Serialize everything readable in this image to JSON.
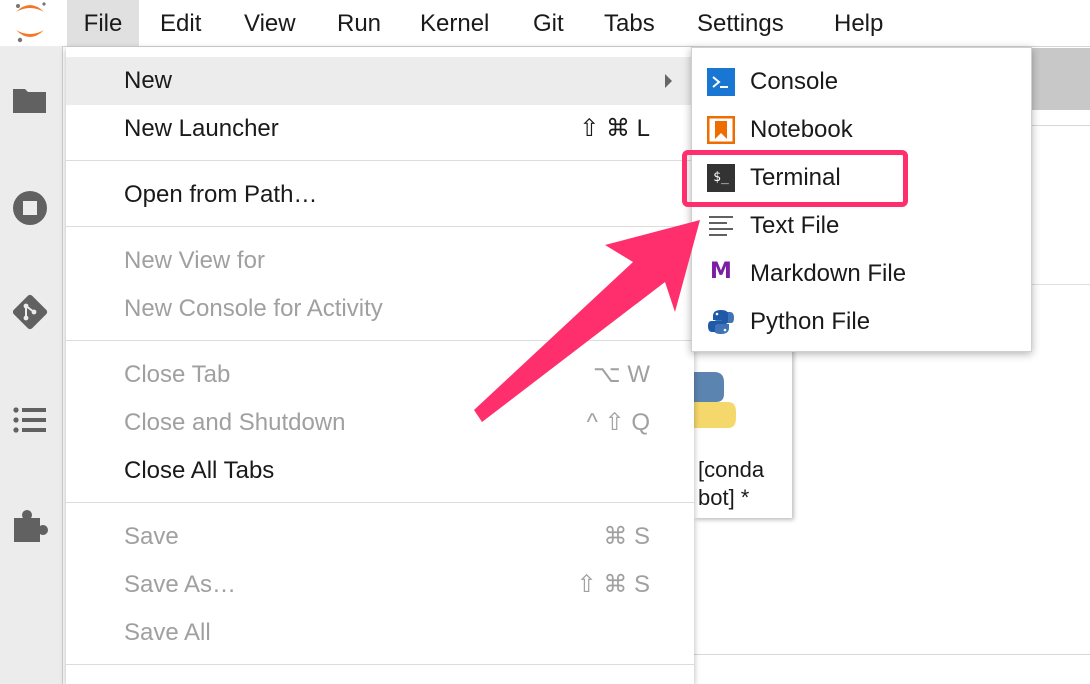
{
  "menubar": {
    "items": [
      "File",
      "Edit",
      "View",
      "Run",
      "Kernel",
      "Git",
      "Tabs",
      "Settings",
      "Help"
    ],
    "active": "File"
  },
  "sidebar": {
    "icons": [
      "folder-icon",
      "stop-circle-icon",
      "git-icon",
      "list-icon",
      "puzzle-icon"
    ]
  },
  "file_menu": {
    "new": {
      "label": "New"
    },
    "new_launcher": {
      "label": "New Launcher",
      "shortcut": "⇧ ⌘ L"
    },
    "open_from_path": {
      "label": "Open from Path…"
    },
    "new_view_for": {
      "label": "New View for"
    },
    "new_console_for_activity": {
      "label": "New Console for Activity"
    },
    "close_tab": {
      "label": "Close Tab",
      "shortcut": "⌥ W"
    },
    "close_and_shutdown": {
      "label": "Close and Shutdown",
      "shortcut": "^ ⇧ Q"
    },
    "close_all_tabs": {
      "label": "Close All Tabs"
    },
    "save": {
      "label": "Save",
      "shortcut": "⌘ S"
    },
    "save_as": {
      "label": "Save As…",
      "shortcut": "⇧ ⌘ S"
    },
    "save_all": {
      "label": "Save All"
    }
  },
  "new_submenu": {
    "console": {
      "label": "Console"
    },
    "notebook": {
      "label": "Notebook"
    },
    "terminal": {
      "label": "Terminal",
      "icon_text": "$_"
    },
    "text_file": {
      "label": "Text File"
    },
    "markdown_file": {
      "label": "Markdown File",
      "icon_text": "M"
    },
    "python_file": {
      "label": "Python File"
    }
  },
  "background": {
    "kernel_card_label": "[conda\nbot] *"
  },
  "colors": {
    "highlight": "#ff2f6d",
    "menu_active_bg": "#e0e0e0",
    "disabled_text": "#a0a0a0",
    "jupyter_orange": "#f37726"
  }
}
